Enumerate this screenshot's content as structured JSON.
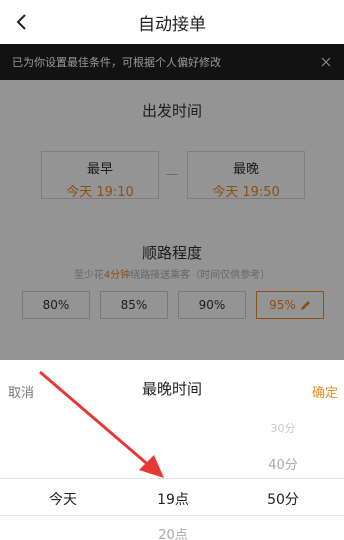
{
  "header": {
    "title": "自动接单"
  },
  "notice": {
    "text": "已为你设置最佳条件，可根据个人偏好修改"
  },
  "depart": {
    "title": "出发时间",
    "earliest": {
      "label": "最早",
      "value": "今天 19:10"
    },
    "latest": {
      "label": "最晚",
      "value": "今天 19:50"
    }
  },
  "route": {
    "title": "顺路程度",
    "subtitle_prefix": "至少花",
    "subtitle_highlight": "4分钟",
    "subtitle_suffix": "绕路接送乘客（时间仅供参考）",
    "options": [
      "80%",
      "85%",
      "90%",
      "95%"
    ],
    "selected": "95%"
  },
  "picker": {
    "cancel": "取消",
    "title": "最晚时间",
    "confirm": "确定",
    "day_column": {
      "selected": "今天"
    },
    "hour_column": {
      "selected": "19点",
      "below": "20点"
    },
    "minute_column": {
      "above2": "30分",
      "above1": "40分",
      "selected": "50分"
    }
  },
  "colors": {
    "accent": "#f08c1c",
    "arrow": "#e53935"
  }
}
